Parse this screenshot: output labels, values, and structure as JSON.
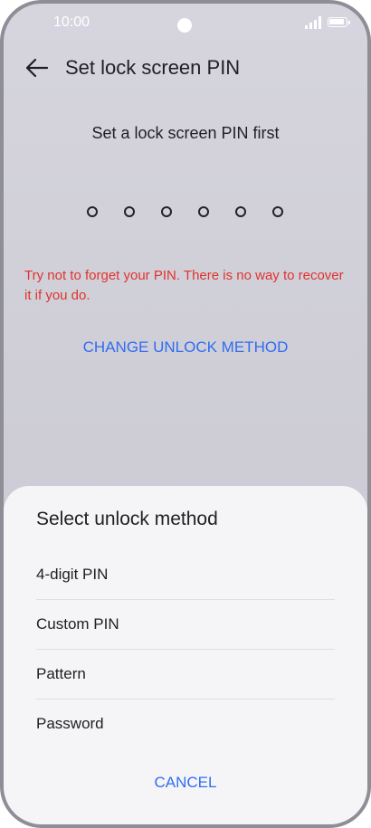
{
  "status_bar": {
    "time": "10:00"
  },
  "header": {
    "title": "Set lock screen PIN",
    "back_icon": "arrow-left-icon"
  },
  "main": {
    "instruction": "Set a lock screen PIN first",
    "pin_length": 6,
    "warning": "Try not to forget your PIN. There is no way to recover it if you do.",
    "change_method_label": "CHANGE UNLOCK METHOD"
  },
  "sheet": {
    "title": "Select unlock method",
    "options": [
      {
        "label": "4-digit PIN"
      },
      {
        "label": "Custom PIN"
      },
      {
        "label": "Pattern"
      },
      {
        "label": "Password"
      }
    ],
    "cancel_label": "CANCEL"
  },
  "colors": {
    "accent": "#2f6df0",
    "warning": "#e0332d"
  }
}
